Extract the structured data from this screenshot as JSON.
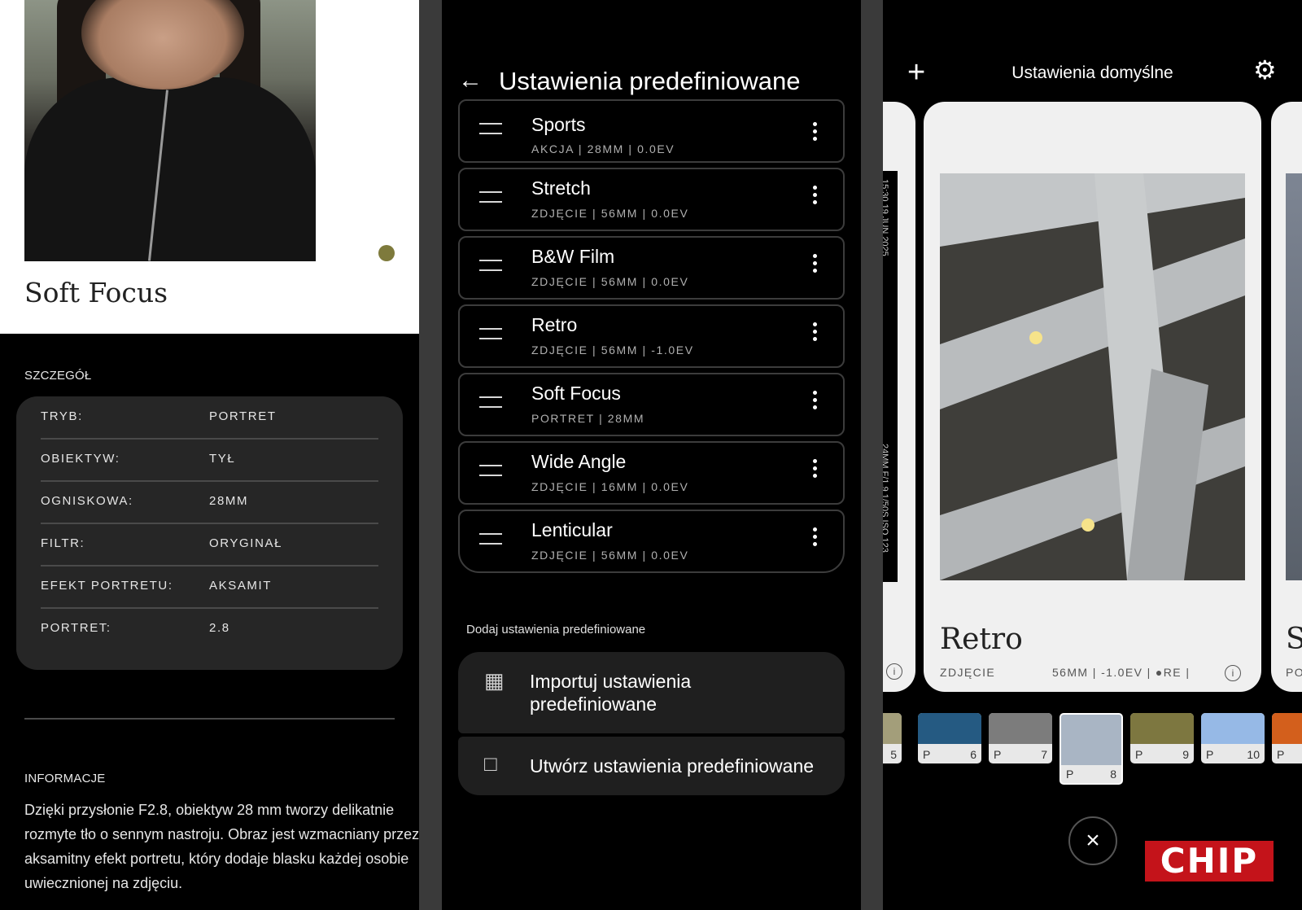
{
  "panel1": {
    "preset_title": "Soft Focus",
    "detail_label": "SZCZEGÓŁ",
    "details": [
      {
        "key": "TRYB:",
        "value": "PORTRET"
      },
      {
        "key": "OBIEKTYW:",
        "value": "TYŁ"
      },
      {
        "key": "OGNISKOWA:",
        "value": "28MM"
      },
      {
        "key": "FILTR:",
        "value": "ORYGINAŁ"
      },
      {
        "key": "EFEKT PORTRETU:",
        "value": "AKSAMIT"
      },
      {
        "key": "PORTRET:",
        "value": "2.8"
      }
    ],
    "info_label": "INFORMACJE",
    "description": "Dzięki przysłonie F2.8, obiektyw 28 mm tworzy delikatnie rozmyte tło o sennym nastroju. Obraz jest wzmacniany przez aksamitny efekt portretu, który dodaje blasku każdej osobie uwiecznionej na zdjęciu.",
    "accent_color": "#7e7a3c"
  },
  "panel2": {
    "title": "Ustawienia predefiniowane",
    "presets": [
      {
        "name": "Sports",
        "meta": "AKCJA  |  28MM  |  0.0EV"
      },
      {
        "name": "Stretch",
        "meta": "ZDJĘCIE  |  56MM  |  0.0EV"
      },
      {
        "name": "B&W Film",
        "meta": "ZDJĘCIE  |  56MM  |  0.0EV"
      },
      {
        "name": "Retro",
        "meta": "ZDJĘCIE  |  56MM  |  -1.0EV"
      },
      {
        "name": "Soft Focus",
        "meta": "PORTRET  |  28MM"
      },
      {
        "name": "Wide Angle",
        "meta": "ZDJĘCIE  |  16MM  |  0.0EV"
      },
      {
        "name": "Lenticular",
        "meta": "ZDJĘCIE  |  56MM  |  0.0EV"
      }
    ],
    "add_label": "Dodaj ustawienia predefiniowane",
    "import_label": "Importuj ustawienia predefiniowane",
    "create_label": "Utwórz ustawienia predefiniowane"
  },
  "panel3": {
    "title": "Ustawienia domyślne",
    "left_strip_top": "15:30 19 JUN 2025",
    "left_strip_bottom": "24MM F/1.9 1/50S ISO 123",
    "card_name": "Retro",
    "card_mode": "ZDJĘCIE",
    "card_meta": "56MM  |  -1.0EV  |  ●RE  |",
    "right_card_letter": "S",
    "right_card_meta": "PO",
    "swatches": [
      {
        "p": "",
        "n": "5",
        "color": "#a39e7a"
      },
      {
        "p": "P",
        "n": "6",
        "color": "#255a82"
      },
      {
        "p": "P",
        "n": "7",
        "color": "#7c7c7c"
      },
      {
        "p": "P",
        "n": "8",
        "color": "#a9b5c4"
      },
      {
        "p": "P",
        "n": "9",
        "color": "#7d7740"
      },
      {
        "p": "P",
        "n": "10",
        "color": "#96b9e6"
      },
      {
        "p": "P",
        "n": "",
        "color": "#d35f1c"
      }
    ],
    "close_icon": "×",
    "logo_text": "CHIP"
  }
}
